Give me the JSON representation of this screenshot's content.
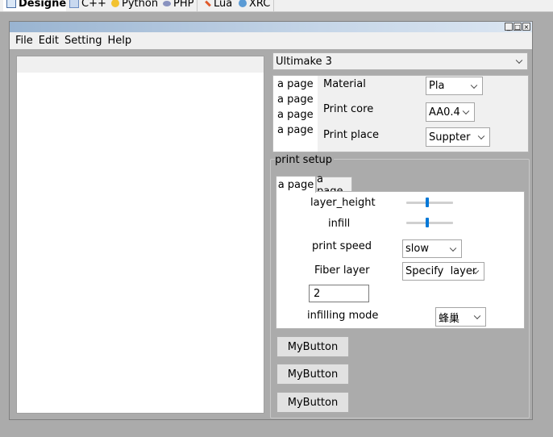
{
  "designer_tabs": [
    {
      "label": "Designer",
      "icon": "designer-icon",
      "active": true
    },
    {
      "label": "C++",
      "icon": "cpp-icon"
    },
    {
      "label": "Python",
      "icon": "python-icon"
    },
    {
      "label": "PHP",
      "icon": "php-icon"
    },
    {
      "label": "Lua",
      "icon": "lua-icon"
    },
    {
      "label": "XRC",
      "icon": "xrc-icon"
    }
  ],
  "window": {
    "buttons": [
      "_",
      "□",
      "×"
    ]
  },
  "menu": [
    "File",
    "Edit",
    "Setting",
    "Help"
  ],
  "printer": {
    "selected": "Ultimake 3"
  },
  "book": {
    "pages": [
      "a page",
      "a page",
      "a page",
      "a page"
    ],
    "material_label": "Material",
    "material_value": "Pla",
    "core_label": "Print core",
    "core_value": "AA0.4",
    "place_label": "Print place",
    "place_value": "Suppter"
  },
  "print_setup": {
    "title": "print setup",
    "tabs": [
      "a page",
      "a page"
    ],
    "layer_height_label": "layer_height",
    "layer_height_level": 0.45,
    "infill_label": "infill",
    "infill_level": 0.45,
    "speed_label": "print speed",
    "speed_value": "slow",
    "fiber_label": "Fiber layer",
    "fiber_value": "Specify  layer",
    "count_value": "2",
    "infilling_label": "infilling mode",
    "infilling_value": "蜂巢"
  },
  "buttons": [
    "MyButton",
    "MyButton",
    "MyButton"
  ],
  "colors": {
    "accent": "#0078d7",
    "background": "#ababab",
    "titlebar": "#99b4d1"
  }
}
